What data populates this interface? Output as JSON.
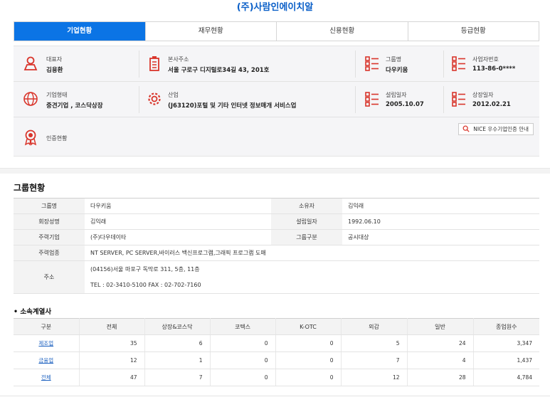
{
  "company": {
    "title": "(주)사람인에이치알"
  },
  "tabs": [
    "기업현황",
    "재무현황",
    "신용현황",
    "등급현황"
  ],
  "info": {
    "ceo": {
      "label": "대표자",
      "value": "김용환"
    },
    "address": {
      "label": "본사주소",
      "value": "서울 구로구 디지털로34길 43, 201호"
    },
    "group": {
      "label": "그룹명",
      "value": "다우키움"
    },
    "bizno": {
      "label": "사업자번호",
      "value": "113-86-0****"
    },
    "form": {
      "label": "기업형태",
      "value": "중견기업 , 코스닥상장"
    },
    "industry": {
      "label": "산업",
      "value": "(J63120)포털 및 기타 인터넷 정보매개 서비스업"
    },
    "founded": {
      "label": "설립일자",
      "value": "2005.10.07"
    },
    "listed": {
      "label": "상장일자",
      "value": "2012.02.21"
    },
    "certification": {
      "label": "인증현황"
    },
    "nice_button": "NICE 우수기업인증 안내"
  },
  "group_section": {
    "title": "그룹현황",
    "rows": {
      "group_name": {
        "label": "그룹명",
        "value": "다우키움"
      },
      "owner": {
        "label": "소유자",
        "value": "김익래"
      },
      "chairman": {
        "label": "회장성명",
        "value": "김익래"
      },
      "founded": {
        "label": "설립일자",
        "value": "1992.06.10"
      },
      "main_company": {
        "label": "주력기업",
        "value": "(주)다우데이타"
      },
      "group_type": {
        "label": "그룹구분",
        "value": "공시대상"
      },
      "main_business": {
        "label": "주력업종",
        "value": "NT SERVER, PC SERVER,바이러스 백신프로그램,그래픽 프로그램 도매"
      },
      "address": {
        "label": "주소",
        "value": "(04156)서울 마포구 독막로 311, 5층, 11층"
      },
      "contact": "TEL : 02-3410-5100 FAX : 02-702-7160"
    }
  },
  "affiliates": {
    "title": "소속계열사",
    "headers": [
      "구분",
      "전체",
      "상장&코스닥",
      "코텍스",
      "K-OTC",
      "외감",
      "일반",
      "종업원수"
    ],
    "rows": [
      [
        "제조업",
        "35",
        "6",
        "0",
        "0",
        "5",
        "24",
        "3,347"
      ],
      [
        "금융업",
        "12",
        "1",
        "0",
        "0",
        "7",
        "4",
        "1,437"
      ],
      [
        "전체",
        "47",
        "7",
        "0",
        "0",
        "12",
        "28",
        "4,784"
      ]
    ]
  }
}
